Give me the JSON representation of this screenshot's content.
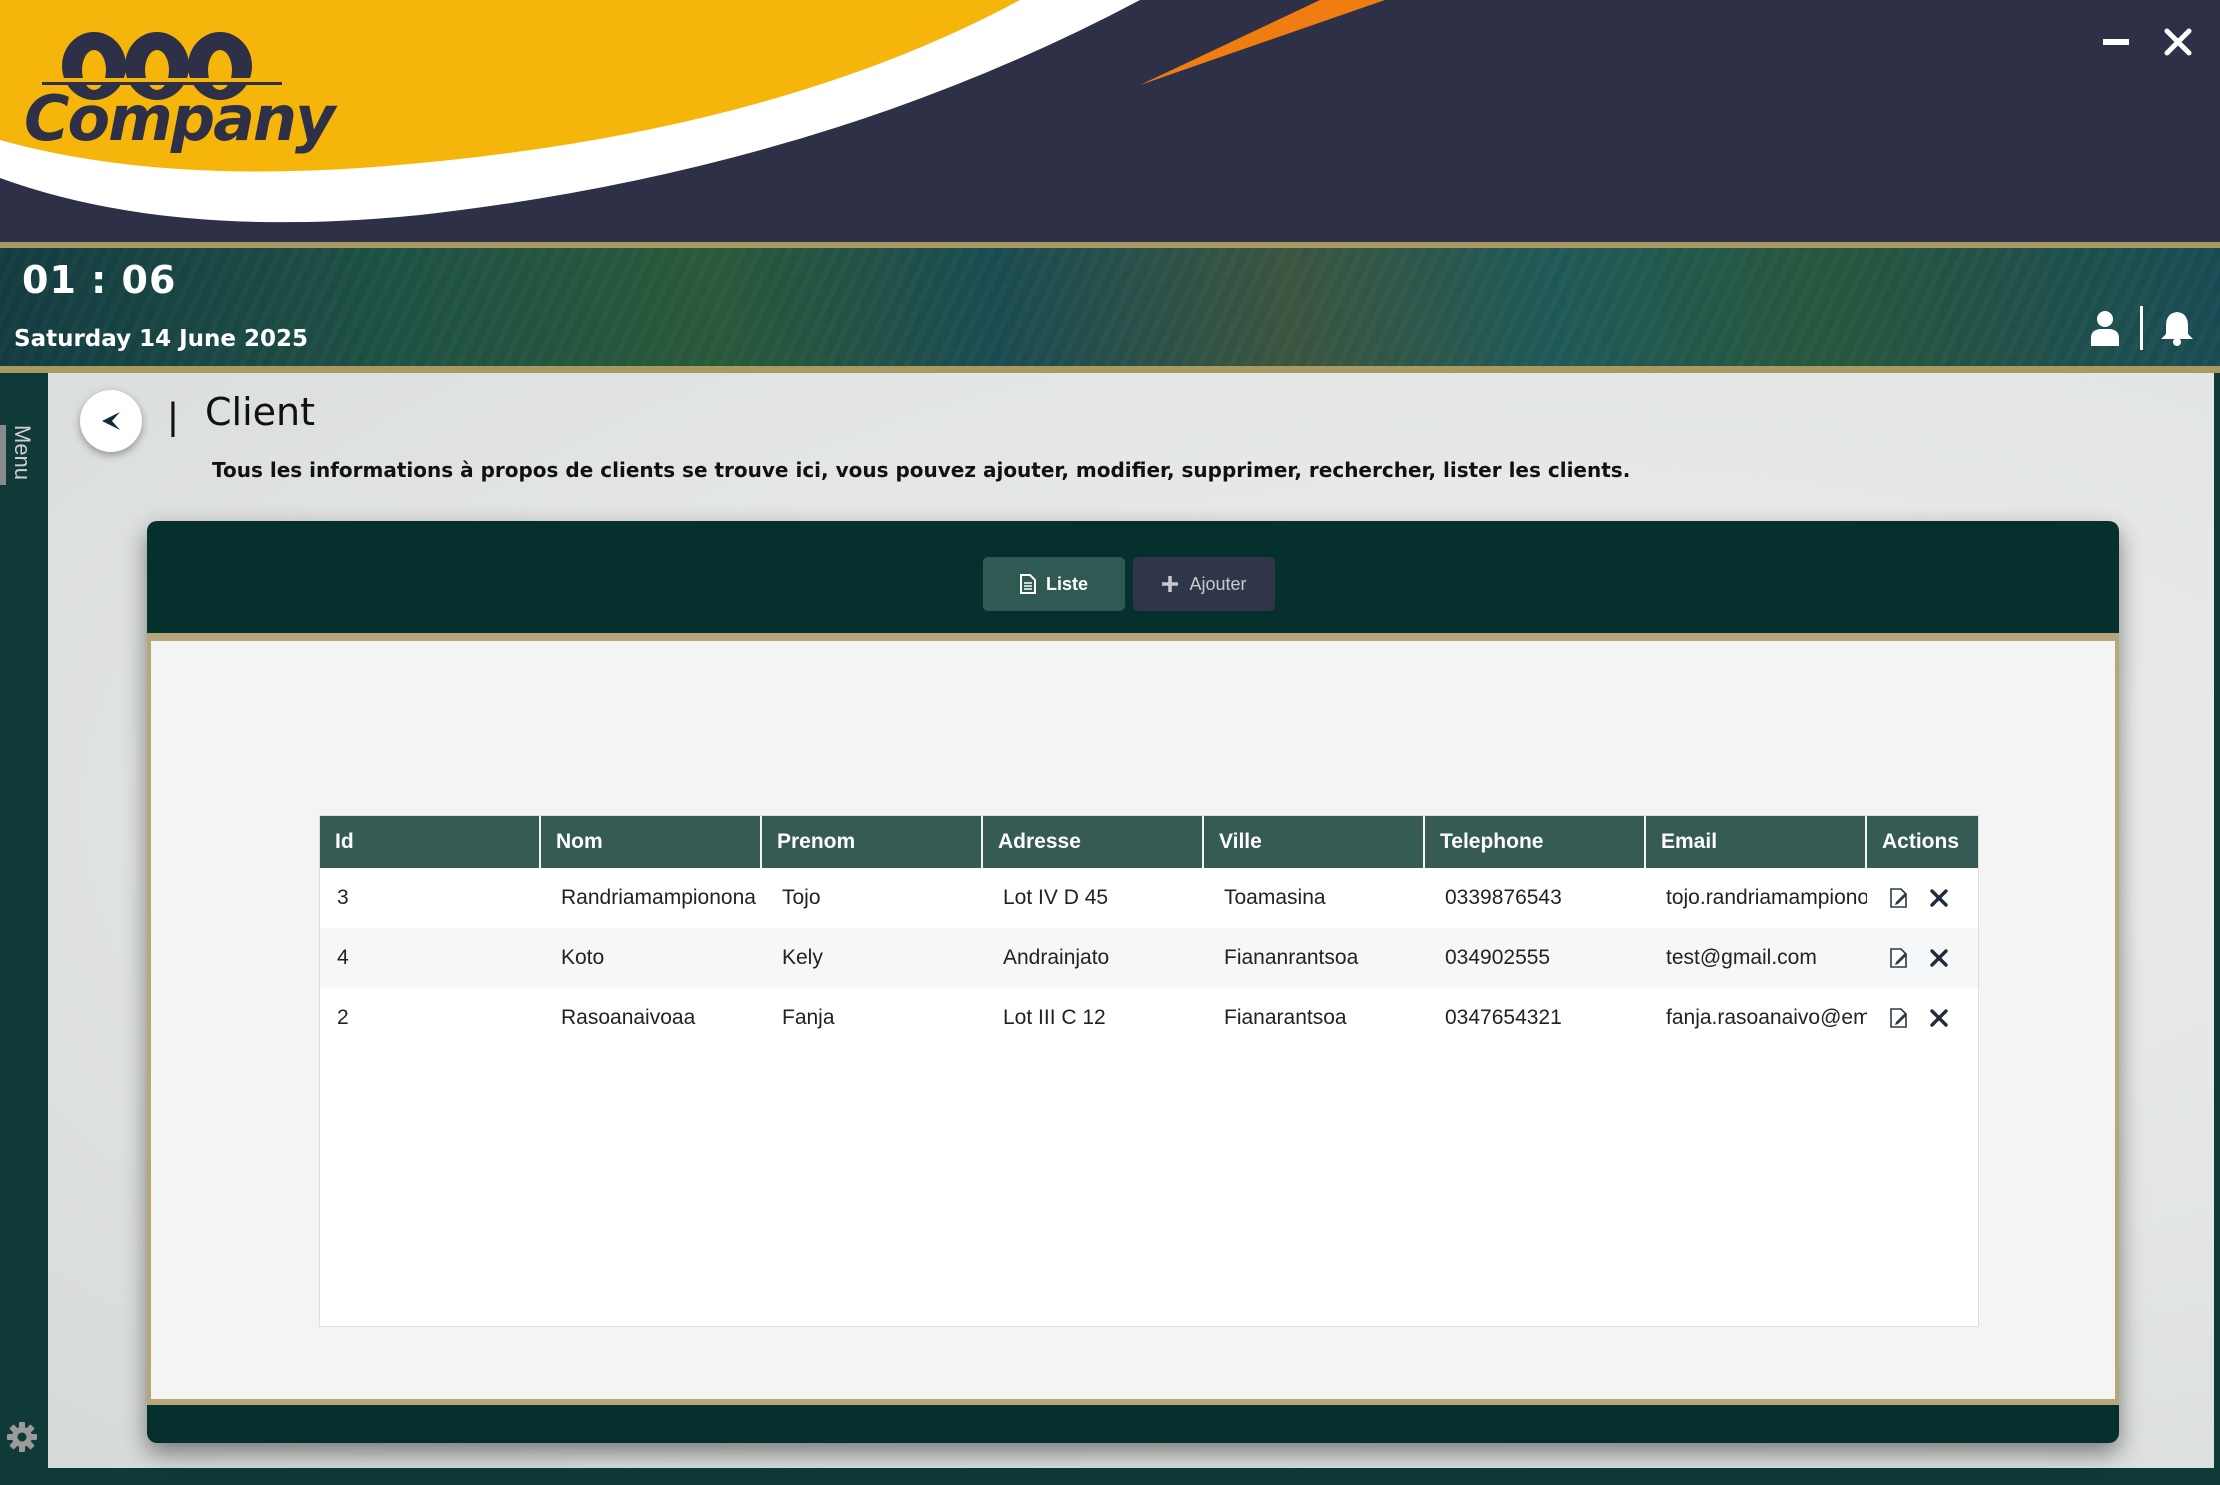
{
  "app": {
    "logo_text": "Company"
  },
  "header": {
    "clock": "01 : 06",
    "date": "Saturday 14 June 2025"
  },
  "rail": {
    "menu_label": "Menu"
  },
  "page": {
    "title": "Client",
    "separator": "|",
    "subtitle": "Tous les informations à propos de clients se trouve ici, vous pouvez ajouter, modifier, supprimer, rechercher, lister les clients."
  },
  "tabs": {
    "liste": "Liste",
    "ajouter": "Ajouter"
  },
  "table": {
    "columns": [
      "Id",
      "Nom",
      "Prenom",
      "Adresse",
      "Ville",
      "Telephone",
      "Email",
      "Actions"
    ],
    "rows": [
      {
        "id": "3",
        "nom": "Randriamampionona",
        "prenom": "Tojo",
        "adresse": "Lot IV D 45",
        "ville": "Toamasina",
        "telephone": "0339876543",
        "email": "tojo.randriamampionona@gmail.com"
      },
      {
        "id": "4",
        "nom": "Koto",
        "prenom": "Kely",
        "adresse": "Andrainjato",
        "ville": "Fiananrantsoa",
        "telephone": "034902555",
        "email": "test@gmail.com"
      },
      {
        "id": "2",
        "nom": "Rasoanaivoaa",
        "prenom": "Fanja",
        "adresse": "Lot III C 12",
        "ville": "Fianarantsoa",
        "telephone": "0347654321",
        "email": "fanja.rasoanaivo@email.com"
      }
    ]
  },
  "colors": {
    "accent_gold": "#f5b50a",
    "banner_dark": "#2d3046",
    "teal_dark": "#06302d",
    "header_cell": "#365a54",
    "orange": "#f07d12"
  },
  "icons": [
    "minimize-icon",
    "close-icon",
    "user-icon",
    "bell-icon",
    "back-arrow-icon",
    "gear-icon",
    "document-icon",
    "plus-icon",
    "edit-icon",
    "delete-icon"
  ]
}
